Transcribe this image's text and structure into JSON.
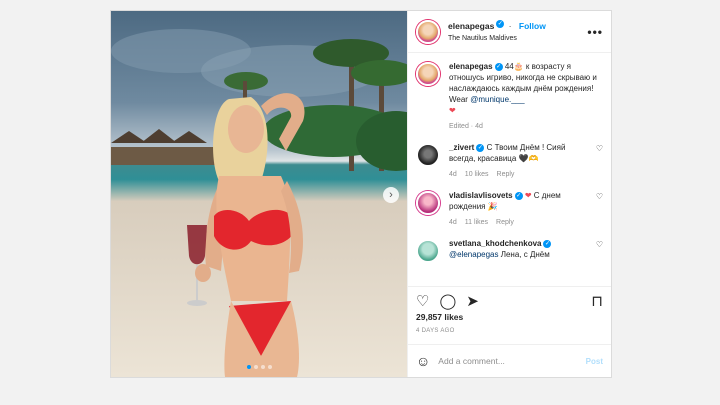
{
  "post": {
    "username": "elenapegas",
    "follow_label": "Follow",
    "location": "The Nautilus Maldives",
    "more_label": "•••",
    "next_label": "›",
    "slide_count": 4,
    "active_slide": 0
  },
  "caption": {
    "username": "elenapegas",
    "text_before": "44🎂 к возрасту я отношусь игриво, никогда не скрываю и наслаждаюсь каждым днём рождения! Wear ",
    "mention": "@munique.___",
    "heart": "❤",
    "meta": "Edited · 4d"
  },
  "comments": [
    {
      "username": "_zivert",
      "text": "С Твоим Днём ! Сияй всегда, красавица 🖤🫶",
      "age": "4d",
      "likes": "10 likes",
      "reply": "Reply",
      "heart": "♡"
    },
    {
      "username": "vladislavlisovets",
      "heart_red": "❤",
      "text": "С днем рождения 🎉",
      "age": "4d",
      "likes": "11 likes",
      "reply": "Reply",
      "heart": "♡"
    },
    {
      "username": "svetlana_khodchenkova",
      "mention": "@elenapegas",
      "text": " Лена, с Днём",
      "heart": "♡"
    }
  ],
  "actions": {
    "like_icon": "♡",
    "comment_icon": "◯",
    "share_icon": "➤",
    "save_icon": "⊓"
  },
  "likes": "29,857 likes",
  "timestamp": "4 DAYS AGO",
  "add_comment": {
    "emoji_icon": "☺",
    "placeholder": "Add a comment...",
    "post_label": "Post"
  }
}
